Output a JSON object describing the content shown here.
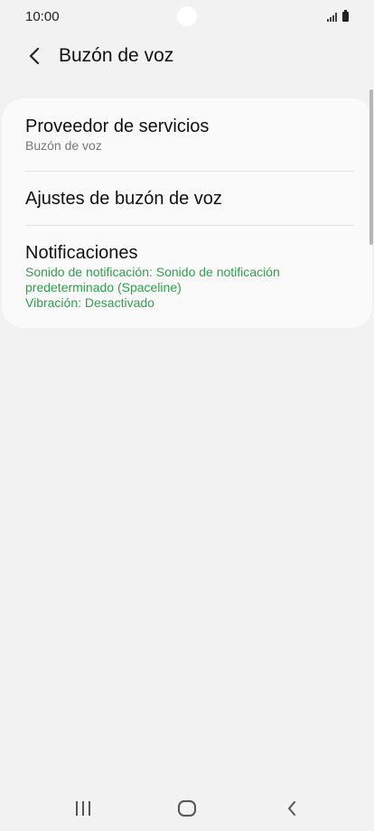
{
  "status_bar": {
    "time": "10:00",
    "signal_icon": "signal-icon",
    "battery_icon": "battery-icon"
  },
  "header": {
    "back_icon": "chevron-left-icon",
    "title": "Buzón de voz"
  },
  "settings": {
    "items": [
      {
        "title": "Proveedor de servicios",
        "subtitle": "Buzón de voz"
      },
      {
        "title": "Ajustes de buzón de voz"
      },
      {
        "title": "Notificaciones",
        "detail_lines": [
          "Sonido de notificación: Sonido de notificación",
          "predeterminado (Spaceline)",
          "Vibración: Desactivado"
        ]
      }
    ]
  },
  "nav_bar": {
    "recents_icon": "recents-icon",
    "home_icon": "home-icon",
    "back_icon": "back-icon"
  },
  "colors": {
    "background": "#f2f2f2",
    "card": "#fafafa",
    "accent_green": "#2ca24a"
  }
}
